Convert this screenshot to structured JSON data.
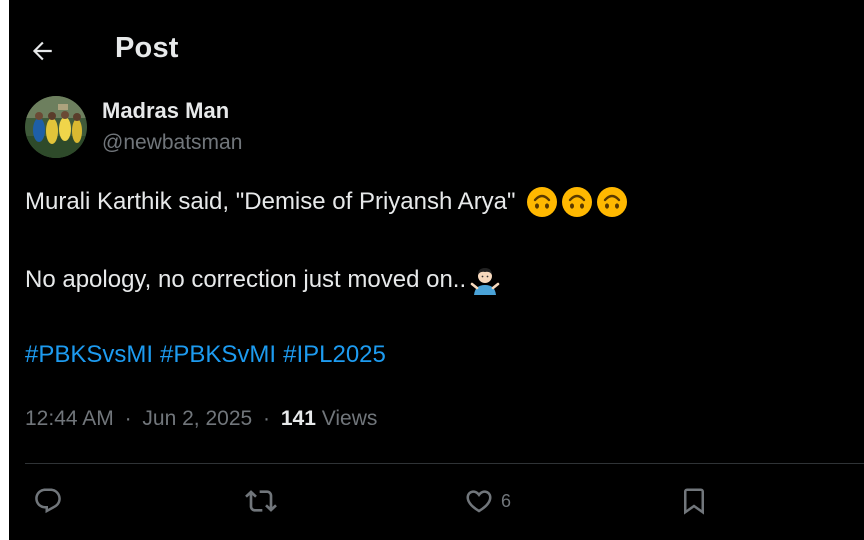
{
  "header": {
    "back_icon": "arrow-left-icon",
    "title": "Post"
  },
  "author": {
    "display_name": "Madras Man",
    "handle": "@newbatsman",
    "avatar": "cricket-team-photo"
  },
  "tweet": {
    "line1_text": "Murali Karthik said, \"Demise of Priyansh Arya\"",
    "line1_emojis": [
      "upside-down-face-emoji",
      "upside-down-face-emoji",
      "upside-down-face-emoji"
    ],
    "line2_text": "No apology, no correction just moved on..",
    "line2_emoji": "person-shrugging-emoji",
    "hashtags": [
      "#PBKSvsMI",
      "#PBKSvMI",
      "#IPL2025"
    ]
  },
  "meta": {
    "time": "12:44 AM",
    "separator": "·",
    "date": "Jun 2, 2025",
    "views_count": "141",
    "views_label": "Views"
  },
  "actions": {
    "reply_icon": "reply-icon",
    "repost_icon": "repost-icon",
    "like_icon": "heart-icon",
    "like_count": "6",
    "bookmark_icon": "bookmark-icon"
  },
  "colors": {
    "background": "#000000",
    "text": "#e7e9ea",
    "secondary_text": "#71767b",
    "link": "#1d9bf0",
    "divider": "#2f3336",
    "emoji_yellow": "#ffb800"
  }
}
